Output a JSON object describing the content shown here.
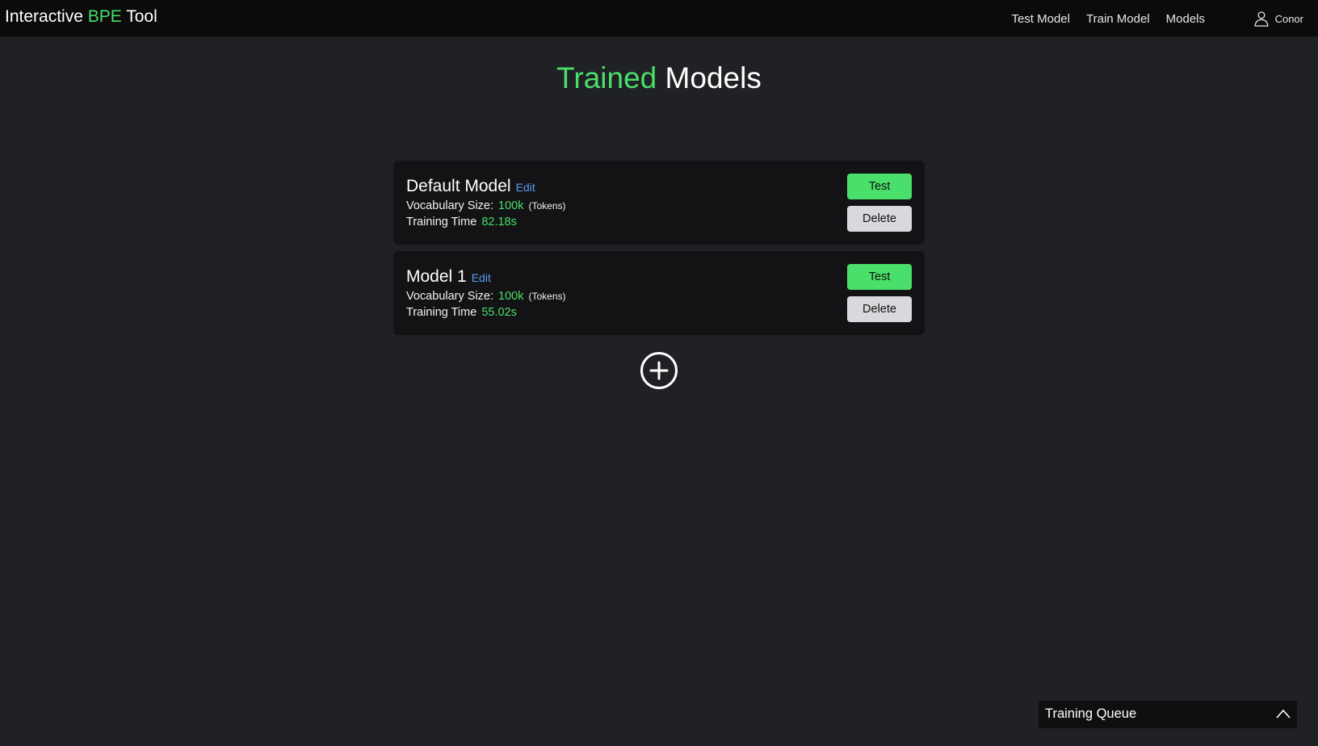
{
  "header": {
    "brand_prefix": "Interactive ",
    "brand_accent": "BPE",
    "brand_suffix": " Tool",
    "nav": [
      {
        "label": "Test Model"
      },
      {
        "label": "Train Model"
      },
      {
        "label": "Models"
      }
    ],
    "user": {
      "name": "Conor",
      "icon": "user-icon"
    }
  },
  "page": {
    "title_accent": "Trained",
    "title_rest": " Models"
  },
  "models": [
    {
      "name": "Default Model",
      "edit_label": "Edit",
      "vocab_label": "Vocabulary Size:",
      "vocab_value": "100k",
      "vocab_unit": "(Tokens)",
      "time_label": "Training Time",
      "time_value": "82.18s",
      "test_label": "Test",
      "delete_label": "Delete"
    },
    {
      "name": "Model 1",
      "edit_label": "Edit",
      "vocab_label": "Vocabulary Size:",
      "vocab_value": "100k",
      "vocab_unit": "(Tokens)",
      "time_label": "Training Time",
      "time_value": "55.02s",
      "test_label": "Test",
      "delete_label": "Delete"
    }
  ],
  "add_model": {
    "icon": "plus-circle-icon"
  },
  "training_queue": {
    "label": "Training Queue",
    "icon": "chevron-up-icon"
  },
  "colors": {
    "background": "#202124",
    "navbar": "#0b0b0c",
    "card": "#131315",
    "accent_green": "#4ade6a",
    "link_blue": "#5b9bf0",
    "delete_button": "#d8d9dc"
  }
}
